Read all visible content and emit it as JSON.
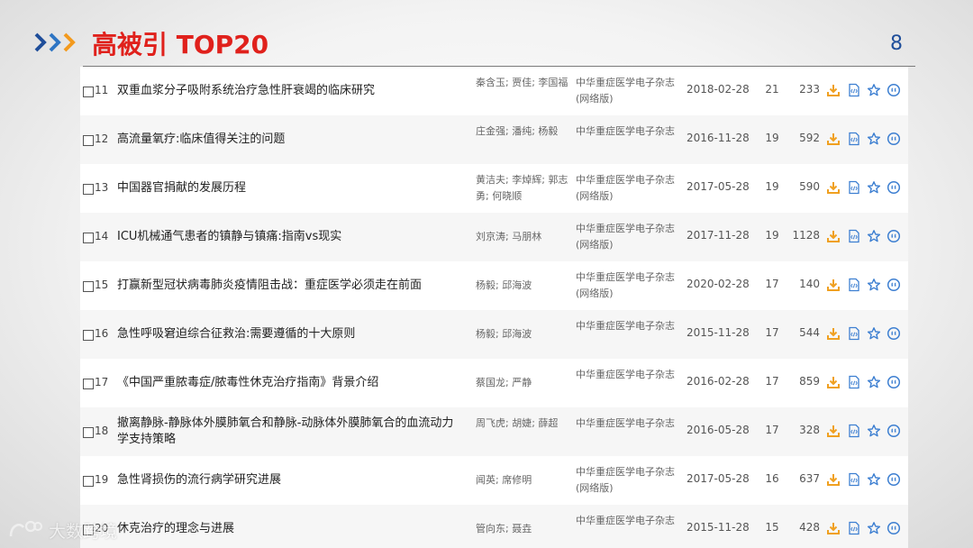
{
  "header": {
    "title": "高被引 TOP20",
    "page_number": "8",
    "title_color": "#e0211c",
    "chevron_colors": [
      "#1f4e9a",
      "#2e75c4",
      "#f39a1e"
    ]
  },
  "rows": [
    {
      "num": "11",
      "title": "双重血浆分子吸附系统治疗急性肝衰竭的临床研究",
      "authors": "秦含玉; 贾佳; 李国福",
      "journal": "中华重症医学电子杂志(网络版)",
      "date": "2018-02-28",
      "cited": "21",
      "downloads": "233"
    },
    {
      "num": "12",
      "title": "高流量氧疗:临床值得关注的问题",
      "authors": "庄金强; 潘纯; 杨毅",
      "journal": "中华重症医学电子杂志",
      "date": "2016-11-28",
      "cited": "19",
      "downloads": "592"
    },
    {
      "num": "13",
      "title": "中国器官捐献的发展历程",
      "authors": "黄洁夫; 李焯辉; 郭志勇; 何晓顺",
      "journal": "中华重症医学电子杂志(网络版)",
      "date": "2017-05-28",
      "cited": "19",
      "downloads": "590"
    },
    {
      "num": "14",
      "title": "ICU机械通气患者的镇静与镇痛:指南vs现实",
      "authors": "刘京涛; 马朋林",
      "journal": "中华重症医学电子杂志(网络版)",
      "date": "2017-11-28",
      "cited": "19",
      "downloads": "1128"
    },
    {
      "num": "15",
      "title": "打赢新型冠状病毒肺炎疫情阻击战：重症医学必须走在前面",
      "authors": "杨毅; 邱海波",
      "journal": "中华重症医学电子杂志(网络版)",
      "date": "2020-02-28",
      "cited": "17",
      "downloads": "140"
    },
    {
      "num": "16",
      "title": "急性呼吸窘迫综合征救治:需要遵循的十大原则",
      "authors": "杨毅; 邱海波",
      "journal": "中华重症医学电子杂志",
      "date": "2015-11-28",
      "cited": "17",
      "downloads": "544"
    },
    {
      "num": "17",
      "title": "《中国严重脓毒症/脓毒性休克治疗指南》背景介绍",
      "authors": "蔡国龙; 严静",
      "journal": "中华重症医学电子杂志",
      "date": "2016-02-28",
      "cited": "17",
      "downloads": "859"
    },
    {
      "num": "18",
      "title": "撤离静脉-静脉体外膜肺氧合和静脉-动脉体外膜肺氧合的血流动力学支持策略",
      "authors": "周飞虎; 胡婕; 薛超",
      "journal": "中华重症医学电子杂志",
      "date": "2016-05-28",
      "cited": "17",
      "downloads": "328"
    },
    {
      "num": "19",
      "title": "急性肾损伤的流行病学研究进展",
      "authors": "闻英; 席修明",
      "journal": "中华重症医学电子杂志(网络版)",
      "date": "2017-05-28",
      "cited": "16",
      "downloads": "637"
    },
    {
      "num": "20",
      "title": "休克治疗的理念与进展",
      "authors": "管向东; 聂垚",
      "journal": "中华重症医学电子杂志",
      "date": "2015-11-28",
      "cited": "15",
      "downloads": "428"
    }
  ],
  "icons": [
    "download-icon",
    "html-read-icon",
    "favorite-star-icon",
    "quote-icon"
  ],
  "icon_colors": {
    "download": "#f0a020",
    "action": "#3d7fd1"
  },
  "watermark": {
    "text": "大数跨境"
  }
}
